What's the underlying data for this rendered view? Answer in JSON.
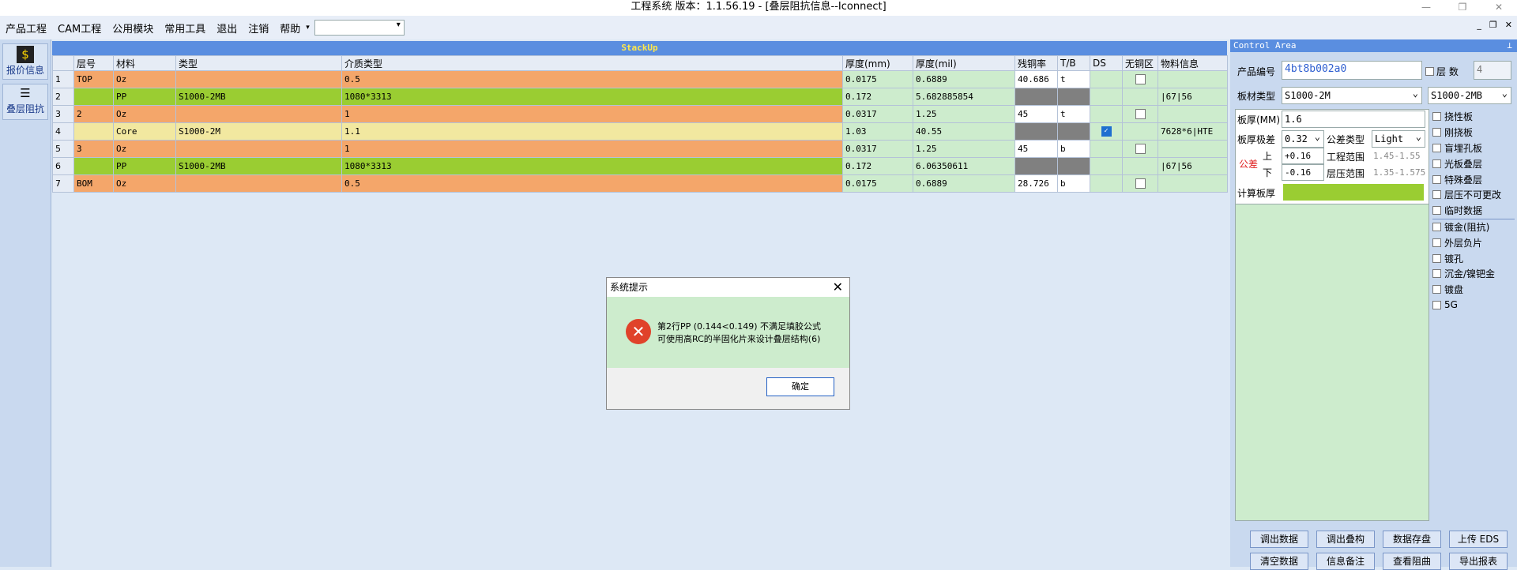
{
  "window": {
    "title": "工程系统   版本：1.1.56.19 - [叠层阻抗信息--Iconnect]"
  },
  "menu": [
    "产品工程",
    "CAM工程",
    "公用模块",
    "常用工具",
    "退出",
    "注销",
    "帮助"
  ],
  "left_nav": [
    {
      "label": "报价信息",
      "icon": "dollar-icon"
    },
    {
      "label": "叠层阻抗",
      "icon": "layers-icon"
    }
  ],
  "stackup": {
    "header": "StackUp",
    "columns": [
      "层号",
      "材料",
      "类型",
      "介质类型",
      "厚度(mm)",
      "厚度(mil)",
      "残铜率",
      "T/B",
      "DS",
      "无铜区",
      "物料信息"
    ],
    "rows": [
      {
        "n": "1",
        "layer": "TOP",
        "material": "Oz",
        "type": "",
        "dielectric": "0.5",
        "mm": "0.0175",
        "mil": "0.6889",
        "res": "40.686",
        "tb": "t",
        "ds": false,
        "nocu": false,
        "info": "",
        "color": "orange"
      },
      {
        "n": "2",
        "layer": "",
        "material": "PP",
        "type": "S1000-2MB",
        "dielectric": "1080*3313",
        "mm": "0.172",
        "mil": "5.682885854",
        "res": "",
        "tb": "",
        "ds": false,
        "nocu": null,
        "info": "|67|56",
        "color": "green"
      },
      {
        "n": "3",
        "layer": "2",
        "material": "Oz",
        "type": "",
        "dielectric": "1",
        "mm": "0.0317",
        "mil": "1.25",
        "res": "45",
        "tb": "t",
        "ds": false,
        "nocu": false,
        "info": "",
        "color": "orange"
      },
      {
        "n": "4",
        "layer": "",
        "material": "Core",
        "type": "S1000-2M",
        "dielectric": "1.1",
        "mm": "1.03",
        "mil": "40.55",
        "res": "",
        "tb": "",
        "ds": true,
        "nocu": null,
        "info": "7628*6|HTE",
        "color": "yellow"
      },
      {
        "n": "5",
        "layer": "3",
        "material": "Oz",
        "type": "",
        "dielectric": "1",
        "mm": "0.0317",
        "mil": "1.25",
        "res": "45",
        "tb": "b",
        "ds": false,
        "nocu": false,
        "info": "",
        "color": "orange"
      },
      {
        "n": "6",
        "layer": "",
        "material": "PP",
        "type": "S1000-2MB",
        "dielectric": "1080*3313",
        "mm": "0.172",
        "mil": "6.06350611",
        "res": "",
        "tb": "",
        "ds": false,
        "nocu": null,
        "info": "|67|56",
        "color": "green"
      },
      {
        "n": "7",
        "layer": "BOM",
        "material": "Oz",
        "type": "",
        "dielectric": "0.5",
        "mm": "0.0175",
        "mil": "0.6889",
        "res": "28.726",
        "tb": "b",
        "ds": false,
        "nocu": false,
        "info": "",
        "color": "orange"
      }
    ]
  },
  "dialog": {
    "title": "系统提示",
    "line1": "第2行PP (0.144<0.149) 不满足填胶公式",
    "line2": "可使用高RC的半固化片来设计叠层结构(6)",
    "ok": "确定"
  },
  "control": {
    "header": "Control Area",
    "product_label": "产品编号",
    "product_value": "4bt8b002a0",
    "layers_label": "层 数",
    "layers_value": "4",
    "board_type_label": "板材类型",
    "board_type_value": "S1000-2M",
    "board_type_value2": "S1000-2MB",
    "thickness_label": "板厚(MM)",
    "thickness_value": "1.6",
    "tol_label": "板厚极差",
    "tol_value": "0.32",
    "tol_type_label": "公差类型",
    "tol_type_value": "Light",
    "tolerance_label": "公差",
    "upper_label": "上",
    "upper_value": "+0.16",
    "lower_label": "下",
    "lower_value": "-0.16",
    "eng_range_label": "工程范围",
    "eng_range_value": "1.45-1.55",
    "press_range_label": "层压范围",
    "press_range_value": "1.35-1.575",
    "calc_label": "计算板厚",
    "options": [
      "挠性板",
      "刚挠板",
      "盲埋孔板",
      "光板叠层",
      "特殊叠层",
      "层压不可更改",
      "临时数据",
      "镀金(阻抗)",
      "外层负片",
      "镀孔",
      "沉金/镍钯金",
      "镀盘",
      "5G"
    ],
    "buttons": [
      "调出数据",
      "调出叠构",
      "数据存盘",
      "上传 EDS",
      "清空数据",
      "信息备注",
      "查看阻曲",
      "导出报表"
    ]
  }
}
